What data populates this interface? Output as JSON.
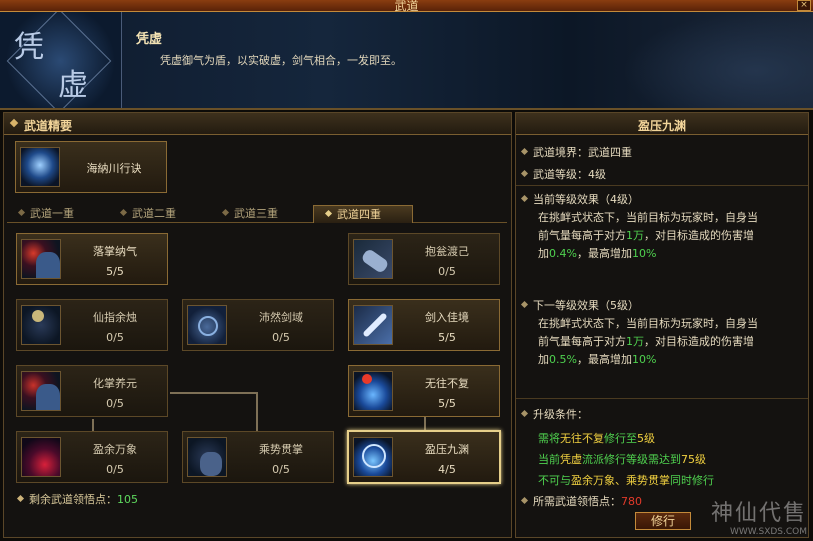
{
  "window": {
    "title": "武道",
    "close": "×"
  },
  "header": {
    "logo_chars": [
      "凭",
      "虚"
    ],
    "skill_name": "凭虚",
    "skill_desc": "凭虚御气为盾，以实破虚，剑气相合，一发即至。"
  },
  "left": {
    "section_title": "武道精要",
    "top_skill": {
      "name": "海納川行诀"
    },
    "tabs": [
      "武道一重",
      "武道二重",
      "武道三重",
      "武道四重"
    ],
    "active_tab": "武道四重",
    "skills": [
      {
        "name": "落掌纳气",
        "level": "5/5",
        "icon": "palm-icon"
      },
      {
        "name": "抱瓮渡己",
        "level": "0/5",
        "icon": "vase-icon"
      },
      {
        "name": "仙指余烛",
        "level": "0/5",
        "icon": "finger-icon"
      },
      {
        "name": "沛然剑域",
        "level": "0/5",
        "icon": "sword-field-icon"
      },
      {
        "name": "剑入佳境",
        "level": "5/5",
        "icon": "sword-icon"
      },
      {
        "name": "化掌养元",
        "level": "0/5",
        "icon": "palm-icon"
      },
      {
        "name": "无往不复",
        "level": "5/5",
        "icon": "orb-icon"
      },
      {
        "name": "盈余万象",
        "level": "0/5",
        "icon": "red-orb-icon"
      },
      {
        "name": "乘势贯掌",
        "level": "0/5",
        "icon": "figure-icon"
      },
      {
        "name": "盈压九渊",
        "level": "4/5",
        "icon": "orb-icon"
      }
    ],
    "points_label": "剩余武道领悟点：",
    "points_value": "105"
  },
  "right": {
    "title": "盈压九渊",
    "realm_label": "武道境界：",
    "realm_value": "武道四重",
    "level_label": "武道等级：",
    "level_value": "4级",
    "current_title": "当前等级效果（",
    "current_level": "4级",
    "current_close": "）",
    "current_desc_1": "在挑衅式状态下，当前目标为玩家时，自身当",
    "current_desc_2a": "前气量每高于对方",
    "current_desc_2b": "1万",
    "current_desc_2c": "，对目标造成的伤害增",
    "current_desc_3a": "加",
    "current_desc_3b": "0.4%",
    "current_desc_3c": "，最高增加",
    "current_desc_3d": "10%",
    "next_title": "下一等级效果（",
    "next_level": "5级",
    "next_close": "）",
    "next_desc_1": "在挑衅式状态下，当前目标为玩家时，自身当",
    "next_desc_2a": "前气量每高于对方",
    "next_desc_2b": "1万",
    "next_desc_2c": "，对目标造成的伤害增",
    "next_desc_3a": "加",
    "next_desc_3b": "0.5%",
    "next_desc_3c": "，最高增加",
    "next_desc_3d": "10%",
    "req_title": "升级条件：",
    "req1a": "需将",
    "req1b": "无往不复",
    "req1c": "修行至",
    "req1d": "5级",
    "req2a": "当前",
    "req2b": "凭虚",
    "req2c": "流派修行等级需达到",
    "req2d": "75级",
    "req3a": "不可与",
    "req3b": "盈余万象、乘势贯掌",
    "req3c": "同时修行",
    "req4a": "所需武道领悟点：",
    "req4b": "780",
    "train_button": "修行"
  },
  "watermark": {
    "line1": "神仙代售",
    "line2": "WWW.SXDS.COM"
  },
  "colors": {
    "green": "#4fd24f",
    "red": "#e23a2a",
    "gold": "#f2d59a",
    "yellow": "#f0d040"
  }
}
